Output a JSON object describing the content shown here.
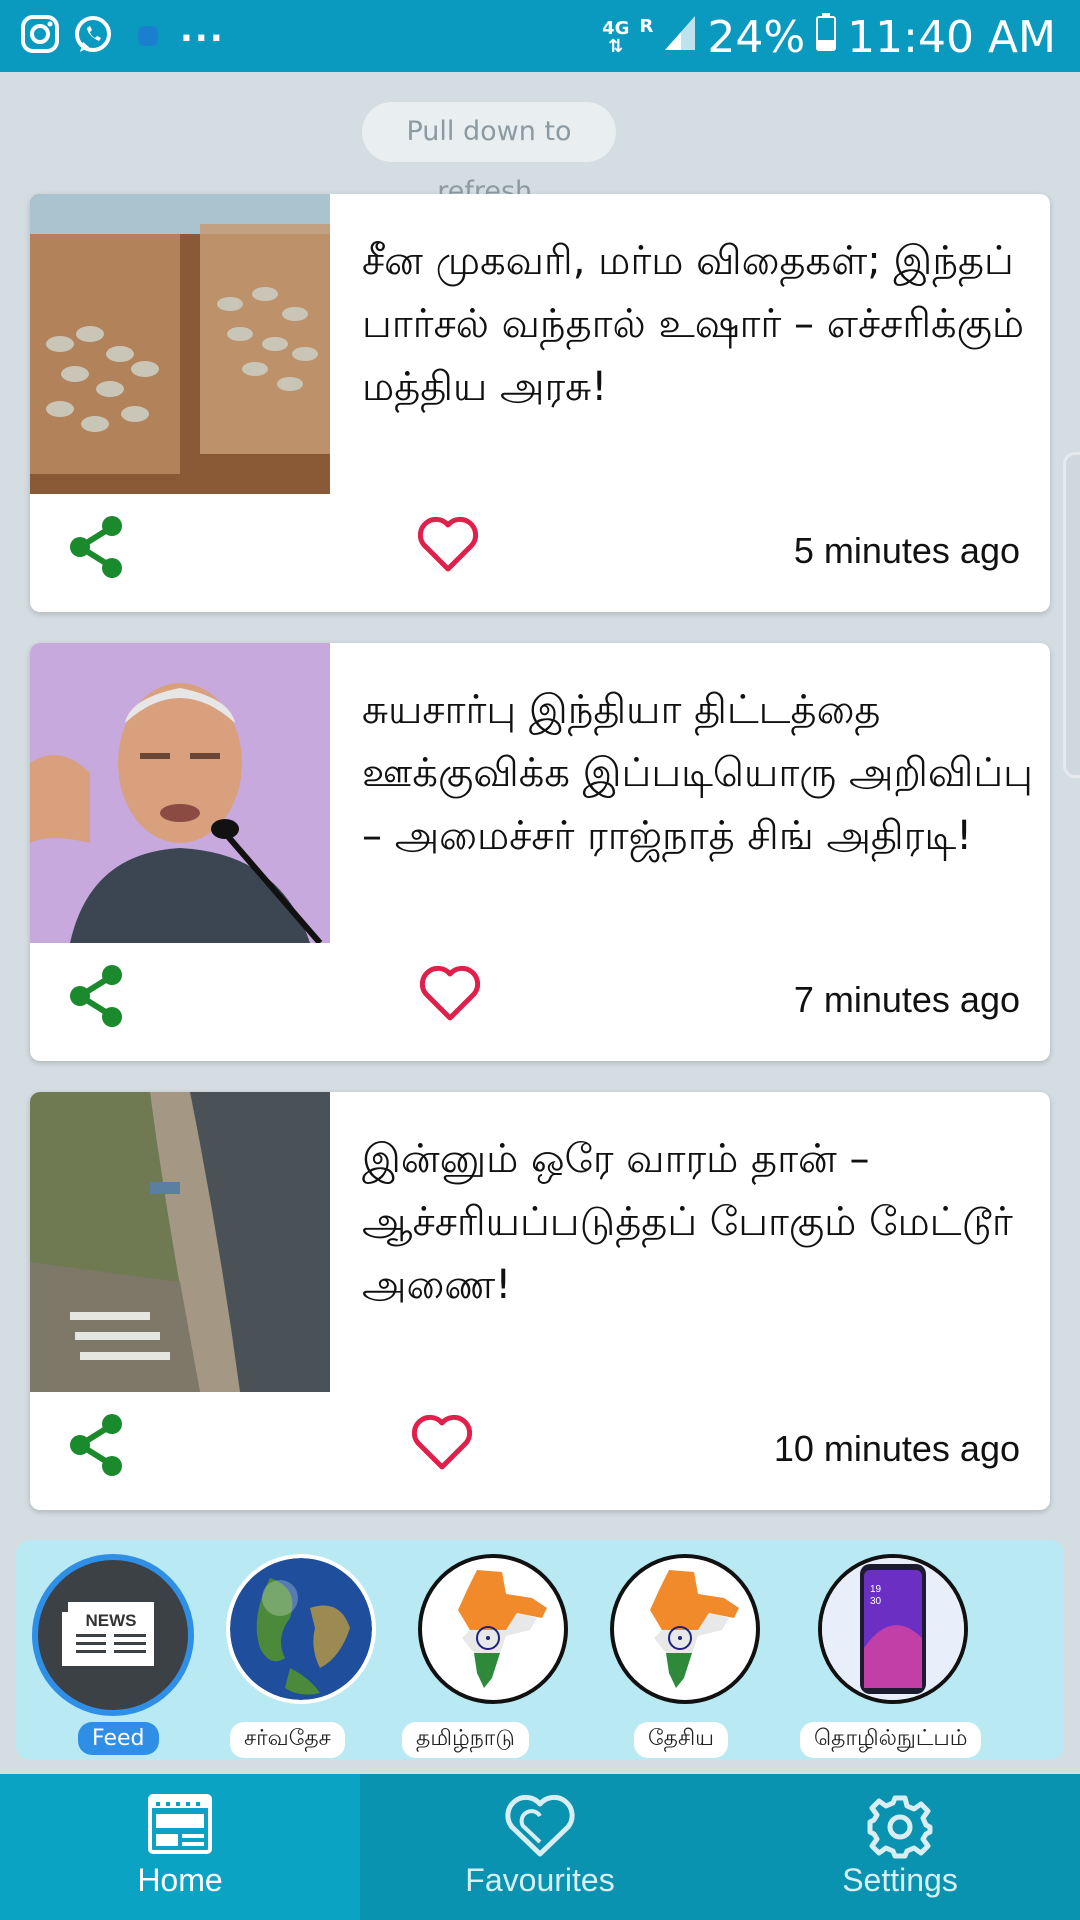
{
  "status_bar": {
    "network": "4G",
    "roaming": "R",
    "battery": "24%",
    "time": "11:40 AM",
    "more": "..."
  },
  "refresh_hint": "Pull down to refresh.",
  "articles": [
    {
      "title": "சீன முகவரி, மர்ம விதைகள்; இந்தப் பார்சல் வந்தால் உஷார் – எச்சரிக்கும் மத்திய அரசு!",
      "time": "5 minutes ago",
      "image": "seed-packets-photo"
    },
    {
      "title": "சுயசார்பு இந்தியா திட்டத்தை ஊக்குவிக்க இப்படியொரு அறிவிப்பு – அமைச்சர் ராஜ்நாத் சிங் அதிரடி!",
      "time": "7 minutes ago",
      "image": "minister-speaking-photo"
    },
    {
      "title": "இன்னும் ஒரே வாரம் தான் – ஆச்சரியப்படுத்தப் போகும் மேட்டூர் அணை!",
      "time": "10 minutes ago",
      "image": "mettur-dam-photo"
    }
  ],
  "categories": [
    {
      "label": "Feed",
      "icon": "newspaper-icon"
    },
    {
      "label": "சர்வதேச",
      "icon": "globe-icon"
    },
    {
      "label": "தமிழ்நாடு",
      "icon": "india-map-icon"
    },
    {
      "label": "தேசிய",
      "icon": "india-map-icon"
    },
    {
      "label": "தொழில்நுட்பம்",
      "icon": "smartphone-icon"
    }
  ],
  "category_icon_text": "NEWS",
  "nav": [
    {
      "label": "Home",
      "icon": "home-news-icon"
    },
    {
      "label": "Favourites",
      "icon": "heart-icon"
    },
    {
      "label": "Settings",
      "icon": "gear-icon"
    }
  ],
  "colors": {
    "primary": "#0a9ac0",
    "share_green": "#1b8a2c",
    "heart_red": "#e0204a",
    "active_blue": "#2f8ee6",
    "background": "#d4dde2"
  }
}
